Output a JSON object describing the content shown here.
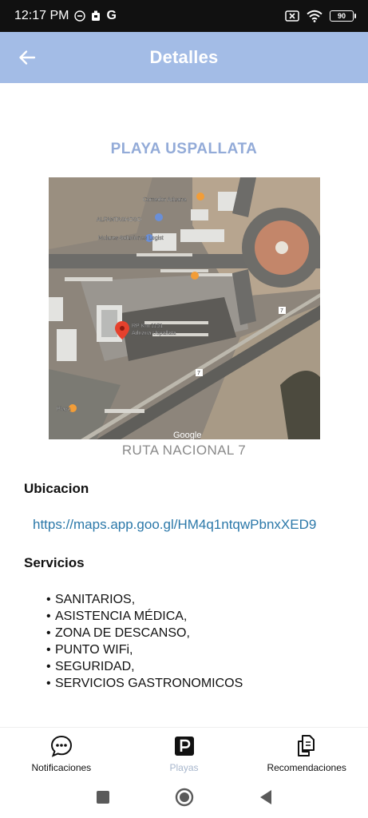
{
  "status_bar": {
    "time": "12:17 PM",
    "carrier_glyph": "G",
    "battery": "90",
    "icons": [
      "dnd-icon",
      "notification-icon",
      "g-icon",
      "sim-off-icon",
      "wifi-icon",
      "battery-icon"
    ]
  },
  "app_bar": {
    "title": "Detalles",
    "back_icon": "arrow-left-icon"
  },
  "place": {
    "name": "PLAYA USPALLATA",
    "route": "RUTA NACIONAL 7"
  },
  "map": {
    "pin_label_line1": "RP Km 1151",
    "pin_label_line2": "Aduana Uspallata",
    "poi_1": "Comedor Aduana",
    "poi_2": "ALFANTASHOSO",
    "poi_3": "Molares Soluciones Logist",
    "poi_4": "Playa",
    "road_7a": "7",
    "road_7b": "7",
    "google": "Google"
  },
  "ubicacion": {
    "heading": "Ubicacion",
    "link": "https://maps.app.goo.gl/HM4q1ntqwPbnxXED9"
  },
  "servicios": {
    "heading": "Servicios",
    "items": [
      "SANITARIOS,",
      "ASISTENCIA MÉDICA,",
      "ZONA DE DESCANSO,",
      "PUNTO WIFi,",
      "SEGURIDAD,",
      "SERVICIOS GASTRONOMICOS"
    ]
  },
  "bottom_nav": {
    "items": [
      {
        "label": "Notificaciones",
        "icon": "chat-bubble-icon"
      },
      {
        "label": "Playas",
        "icon": "parking-icon"
      },
      {
        "label": "Recomendaciones",
        "icon": "documents-icon"
      }
    ]
  },
  "system_nav": [
    "recents-button",
    "home-button",
    "back-button"
  ],
  "colors": {
    "app_bar": "#a3bce6",
    "title_accent": "#93abd8",
    "link": "#2b78a9",
    "inactive_nav": "#a7b6cc"
  }
}
